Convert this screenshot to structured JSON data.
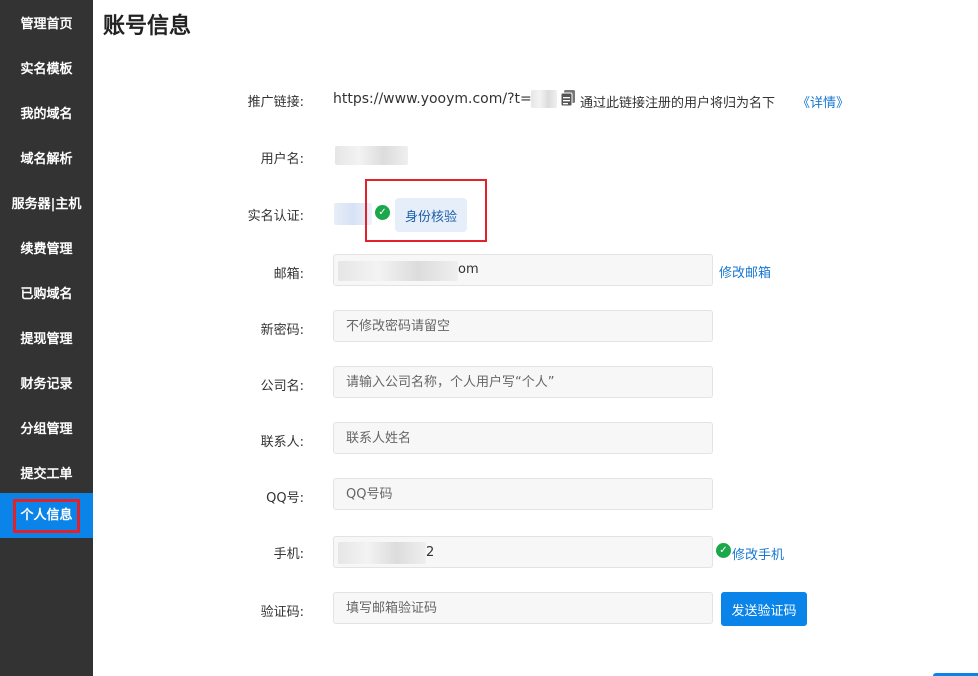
{
  "sidebar": {
    "items": [
      {
        "label": "管理首页"
      },
      {
        "label": "实名模板"
      },
      {
        "label": "我的域名"
      },
      {
        "label": "域名解析"
      },
      {
        "label": "服务器|主机"
      },
      {
        "label": "续费管理"
      },
      {
        "label": "已购域名"
      },
      {
        "label": "提现管理"
      },
      {
        "label": "财务记录"
      },
      {
        "label": "分组管理"
      },
      {
        "label": "提交工单"
      },
      {
        "label": "个人信息"
      }
    ],
    "active_index": 11
  },
  "page": {
    "title": "账号信息"
  },
  "form": {
    "referral": {
      "label": "推广链接:",
      "url": "https://www.yooym.com/?t=2",
      "note": "通过此链接注册的用户将归为名下",
      "details_link": "《详情》"
    },
    "username": {
      "label": "用户名:"
    },
    "real_name": {
      "label": "实名认证:",
      "verify_button": "身份核验"
    },
    "email": {
      "label": "邮箱:",
      "value_suffix": "om",
      "action": "修改邮箱"
    },
    "new_password": {
      "label": "新密码:",
      "placeholder": "不修改密码请留空"
    },
    "company": {
      "label": "公司名:",
      "placeholder": "请输入公司名称，个人用户写“个人”"
    },
    "contact": {
      "label": "联系人:",
      "placeholder": "联系人姓名"
    },
    "qq": {
      "label": "QQ号:",
      "placeholder": "QQ号码"
    },
    "phone": {
      "label": "手机:",
      "value_suffix": "2",
      "action": "修改手机"
    },
    "code": {
      "label": "验证码:",
      "placeholder": "填写邮箱验证码",
      "send_button": "发送验证码"
    }
  },
  "colors": {
    "sidebar_bg": "#333333",
    "accent": "#0a84e8",
    "highlight": "#e2212b",
    "success": "#1aa84b"
  },
  "icons": {
    "copy": "copy-icon",
    "check": "check-circle-icon"
  }
}
